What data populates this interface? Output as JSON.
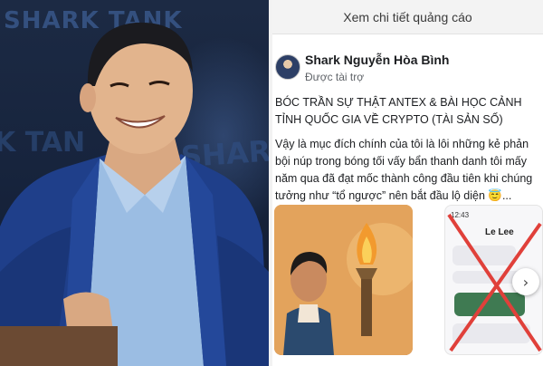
{
  "left_photo": {
    "background_text_1": "SHARK TANK",
    "background_text_2": "SHARK",
    "background_text_3": "K TAN"
  },
  "ad_bar": {
    "link_label": "Xem chi tiết quảng cáo"
  },
  "post": {
    "author": "Shark Nguyễn Hòa Bình",
    "sponsored_label": "Được tài trợ",
    "title": "BÓC TRẦN SỰ THẬT ANTEX & BÀI HỌC CẢNH TỈNH QUỐC GIA VỀ CRYPTO (TÀI SẢN SỐ)",
    "body": "Vậy là mục đích chính của tôi là lôi những kẻ phản bội núp trong bóng tối vấy bẩn thanh danh tôi mấy năm qua đã đạt mốc thành công đầu tiên khi chúng tưởng như “tổ ngược” nên bắt đầu lộ diện 😇..."
  },
  "media": {
    "chat_time": "12:43",
    "chat_contact": "Le Lee",
    "next_icon": "chevron-right-icon"
  },
  "colors": {
    "left_bg": "#17243d",
    "stage_text": "#3d5e93",
    "ad_bar_bg": "#f3f3f3",
    "torch_flame": "#f29a2e",
    "red_cross": "#e0403a"
  }
}
